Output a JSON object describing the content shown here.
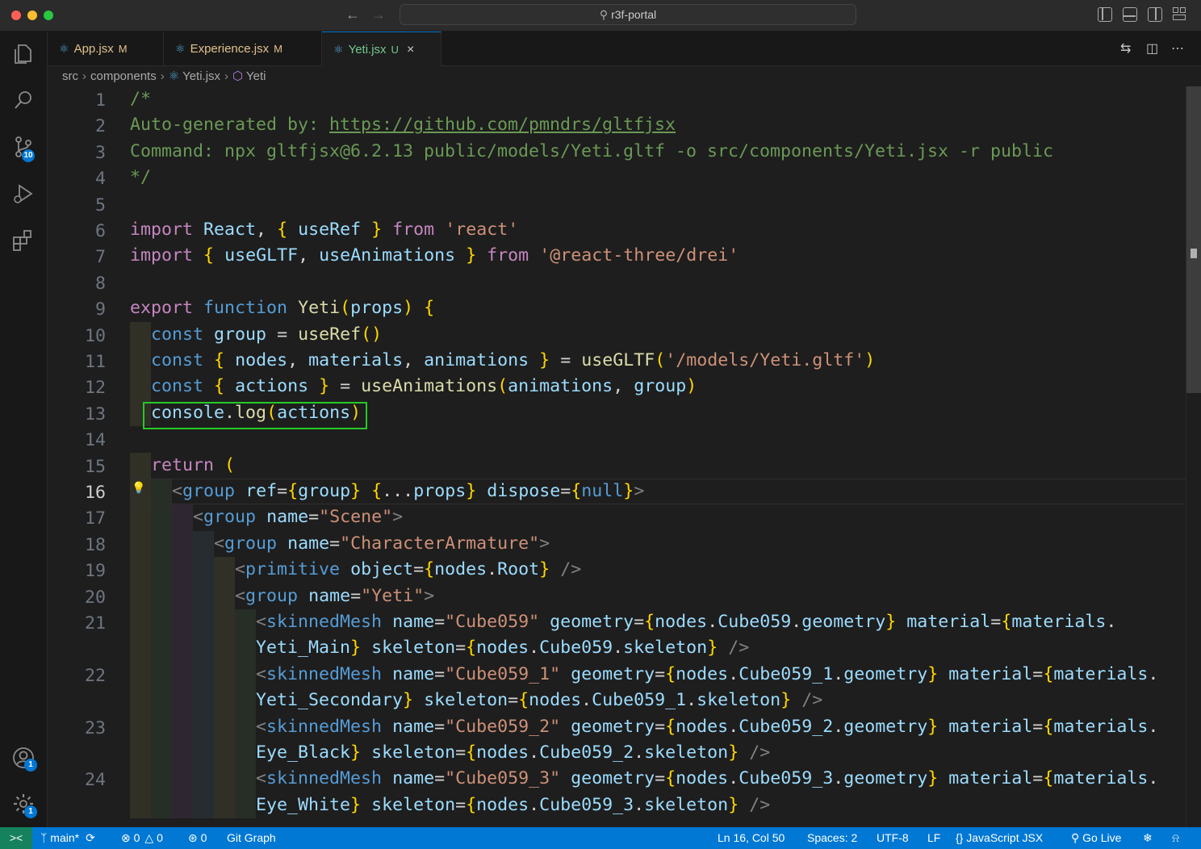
{
  "window": {
    "title": "r3f-portal"
  },
  "tabs": [
    {
      "name": "App.jsx",
      "status": "M"
    },
    {
      "name": "Experience.jsx",
      "status": "M"
    },
    {
      "name": "Yeti.jsx",
      "status": "U",
      "close": "×"
    }
  ],
  "breadcrumb": [
    "src",
    "components",
    "Yeti.jsx",
    "Yeti"
  ],
  "activity": {
    "source_control_badge": "10",
    "accounts_badge": "1",
    "manage_badge": "1"
  },
  "editor": {
    "lines": [
      {
        "n": "1",
        "code": "/*"
      },
      {
        "n": "2",
        "code": "Auto-generated by: https://github.com/pmndrs/gltfjsx"
      },
      {
        "n": "3",
        "code": "Command: npx gltfjsx@6.2.13 public/models/Yeti.gltf -o src/components/Yeti.jsx -r public"
      },
      {
        "n": "4",
        "code": "*/"
      },
      {
        "n": "5",
        "code": ""
      },
      {
        "n": "6",
        "code": "import React, { useRef } from 'react'"
      },
      {
        "n": "7",
        "code": "import { useGLTF, useAnimations } from '@react-three/drei'"
      },
      {
        "n": "8",
        "code": ""
      },
      {
        "n": "9",
        "code": "export function Yeti(props) {"
      },
      {
        "n": "10",
        "code": "  const group = useRef()"
      },
      {
        "n": "11",
        "code": "  const { nodes, materials, animations } = useGLTF('/models/Yeti.gltf')"
      },
      {
        "n": "12",
        "code": "  const { actions } = useAnimations(animations, group)"
      },
      {
        "n": "13",
        "code": "  console.log(actions)"
      },
      {
        "n": "14",
        "code": ""
      },
      {
        "n": "15",
        "code": "  return ("
      },
      {
        "n": "16",
        "code": "    <group ref={group} {...props} dispose={null}>"
      },
      {
        "n": "17",
        "code": "      <group name=\"Scene\">"
      },
      {
        "n": "18",
        "code": "        <group name=\"CharacterArmature\">"
      },
      {
        "n": "19",
        "code": "          <primitive object={nodes.Root} />"
      },
      {
        "n": "20",
        "code": "          <group name=\"Yeti\">"
      },
      {
        "n": "21",
        "code": "            <skinnedMesh name=\"Cube059\" geometry={nodes.Cube059.geometry} material={materials.Yeti_Main} skeleton={nodes.Cube059.skeleton} />"
      },
      {
        "n": "22",
        "code": "            <skinnedMesh name=\"Cube059_1\" geometry={nodes.Cube059_1.geometry} material={materials.Yeti_Secondary} skeleton={nodes.Cube059_1.skeleton} />"
      },
      {
        "n": "23",
        "code": "            <skinnedMesh name=\"Cube059_2\" geometry={nodes.Cube059_2.geometry} material={materials.Eye_Black} skeleton={nodes.Cube059_2.skeleton} />"
      },
      {
        "n": "24",
        "code": "            <skinnedMesh name=\"Cube059_3\" geometry={nodes.Cube059_3.geometry} material={materials.Eye_White} skeleton={nodes.Cube059_3.skeleton} />"
      }
    ],
    "current_line": "16"
  },
  "statusbar": {
    "remote_icon": "><",
    "branch": "main*",
    "errors": "0",
    "warnings": "0",
    "ports": "0",
    "git_graph": "Git Graph",
    "position": "Ln 16, Col 50",
    "spaces": "Spaces: 2",
    "encoding": "UTF-8",
    "eol": "LF",
    "language": "JavaScript JSX",
    "go_live": "Go Live"
  },
  "colors": {
    "accent": "#0078d4",
    "highlight_box": "#26c926",
    "modified": "#e2c08d",
    "untracked": "#73c991"
  }
}
